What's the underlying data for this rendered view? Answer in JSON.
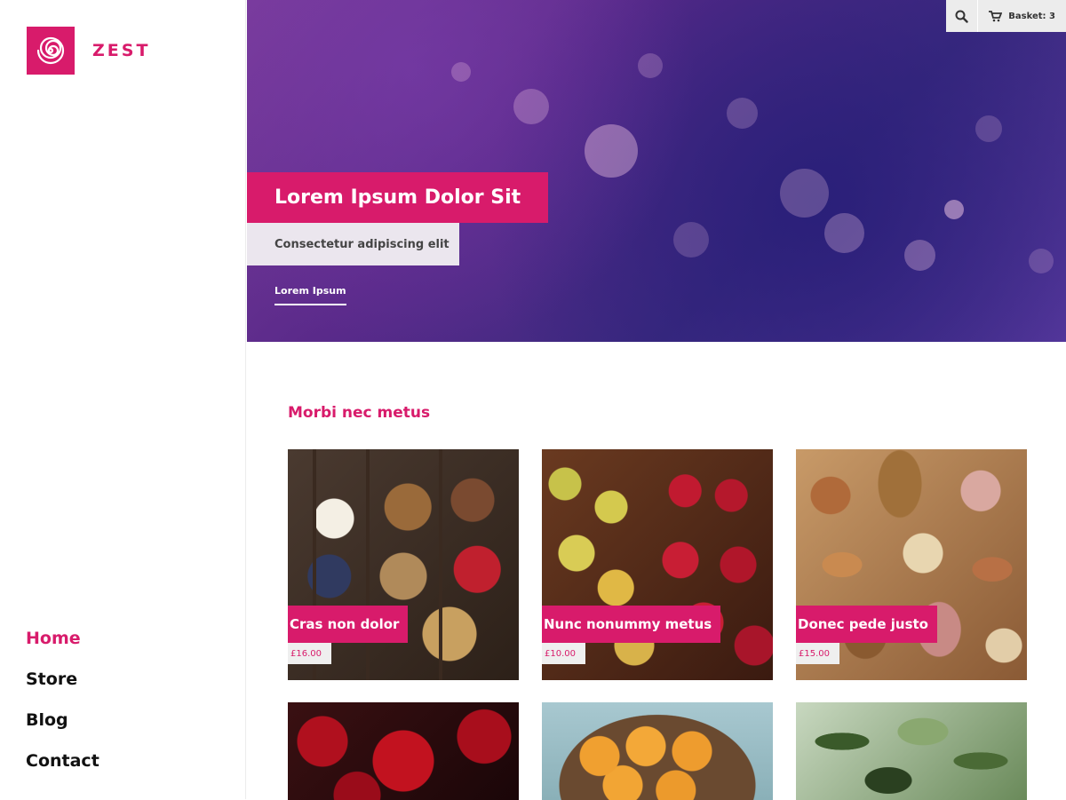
{
  "brand": {
    "name": "ZEST",
    "color": "#d81b6b",
    "logo_icon": "spiral-icon"
  },
  "nav": {
    "items": [
      "Home",
      "Store",
      "Blog",
      "Contact"
    ],
    "active": "Home"
  },
  "topbar": {
    "search_icon": "search-icon",
    "basket_icon": "cart-icon",
    "basket_label": "Basket: 3"
  },
  "hero": {
    "title": "Lorem Ipsum Dolor Sit",
    "subtitle": "Consectetur adipiscing elit",
    "link": "Lorem Ipsum"
  },
  "section": {
    "title": "Morbi nec metus"
  },
  "products": [
    {
      "name": "Cras non dolor",
      "price": "£16.00"
    },
    {
      "name": "Nunc nonummy metus",
      "price": "£10.00"
    },
    {
      "name": "Donec pede justo",
      "price": "£15.00"
    }
  ]
}
